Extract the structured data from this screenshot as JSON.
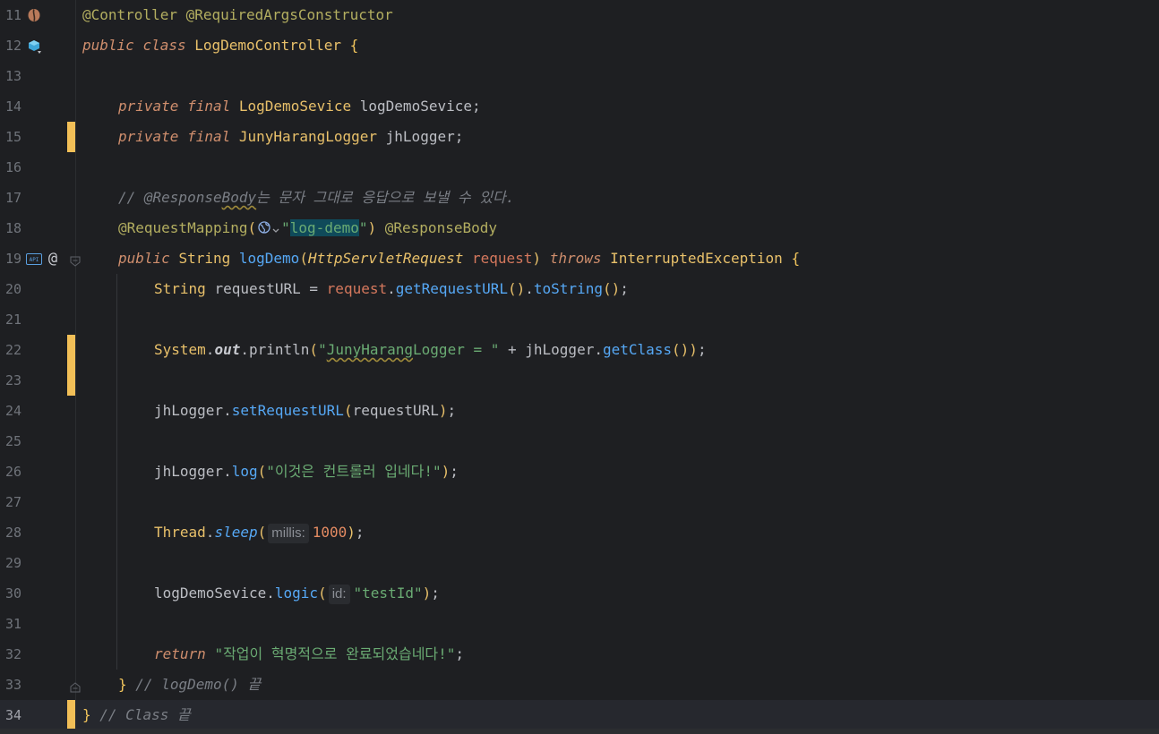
{
  "editor": {
    "lines": [
      {
        "n": "11"
      },
      {
        "n": "12"
      },
      {
        "n": "13"
      },
      {
        "n": "14"
      },
      {
        "n": "15"
      },
      {
        "n": "16"
      },
      {
        "n": "17"
      },
      {
        "n": "18"
      },
      {
        "n": "19"
      },
      {
        "n": "20"
      },
      {
        "n": "21"
      },
      {
        "n": "22"
      },
      {
        "n": "23"
      },
      {
        "n": "24"
      },
      {
        "n": "25"
      },
      {
        "n": "26"
      },
      {
        "n": "27"
      },
      {
        "n": "28"
      },
      {
        "n": "29"
      },
      {
        "n": "30"
      },
      {
        "n": "31"
      },
      {
        "n": "32"
      },
      {
        "n": "33"
      },
      {
        "n": "34"
      }
    ],
    "current_line": "34",
    "changed_lines": [
      "15",
      "22",
      "23",
      "34"
    ],
    "code": {
      "l11": {
        "ann1": "@Controller",
        "sp": " ",
        "ann2": "@RequiredArgsConstructor"
      },
      "l12": {
        "kw1": "public",
        "kw2": "class",
        "cls": "LogDemoController",
        "brace": "{"
      },
      "l14": {
        "kw1": "private",
        "kw2": "final",
        "type": "LogDemoSevice",
        "name": "logDemoSevice",
        "semi": ";"
      },
      "l15": {
        "kw1": "private",
        "kw2": "final",
        "type": "JunyHarangLogger",
        "name": "jhLogger",
        "semi": ";"
      },
      "l17": {
        "c1": "// @Response",
        "c2": "Body",
        "c3": "는 문자 그대로 응답으로 보낼 수 있다."
      },
      "l18": {
        "ann": "@RequestMapping",
        "p1": "(",
        "q1": "\"",
        "val": "log-demo",
        "q2": "\"",
        "p2": ")",
        "ann2": "@ResponseBody"
      },
      "l19": {
        "kw": "public",
        "type": "String",
        "meth": "logDemo",
        "p1": "(",
        "ptype": "HttpServletRequest",
        "pname": "request",
        "p2": ")",
        "throws": "throws",
        "exc": "InterruptedException",
        "brace": "{"
      },
      "l20": {
        "type": "String",
        "name": "requestURL",
        "eq": " = ",
        "obj": "request",
        "dot1": ".",
        "m1": "getRequestURL",
        "p1": "()",
        "dot2": ".",
        "m2": "toString",
        "p2": "()",
        "semi": ";"
      },
      "l22": {
        "cls": "System",
        "dot1": ".",
        "fld": "out",
        "dot2": ".",
        "m": "println",
        "p1": "(",
        "s1": "\"",
        "s2": "JunyHarang",
        "s3": "Logger = \"",
        "plus": " + ",
        "obj": "jhLogger",
        "dot3": ".",
        "m2": "getClass",
        "p2": "())",
        "semi": ";"
      },
      "l24": {
        "obj": "jhLogger",
        "dot": ".",
        "m": "setRequestURL",
        "p1": "(",
        "arg": "requestURL",
        "p2": ")",
        "semi": ";"
      },
      "l26": {
        "obj": "jhLogger",
        "dot": ".",
        "m": "log",
        "p1": "(",
        "str": "\"이것은 컨트롤러 입네다!\"",
        "p2": ")",
        "semi": ";"
      },
      "l28": {
        "cls": "Thread",
        "dot": ".",
        "m": "sleep",
        "p1": "(",
        "hint": "millis:",
        "num": "1000",
        "p2": ")",
        "semi": ";"
      },
      "l30": {
        "obj": "logDemoSevice",
        "dot": ".",
        "m": "logic",
        "p1": "(",
        "hint": "id:",
        "str": "\"testId\"",
        "p2": ")",
        "semi": ";"
      },
      "l32": {
        "kw": "return",
        "str": "\"작업이 혁명적으로 완료되었습네다!\"",
        "semi": ";"
      },
      "l33": {
        "brace": "}",
        "cmt": "// logDemo() 끝"
      },
      "l34": {
        "brace": "}",
        "cmt": "// Class 끝"
      }
    }
  },
  "colors": {
    "background": "#1e1f22",
    "keyword": "#cf8e6d",
    "string": "#6aab73",
    "method": "#56a8f5",
    "annotation": "#b3ae60",
    "comment": "#7a7e85",
    "number": "#e48b62",
    "change_marker": "#f2bf57"
  },
  "icons": {
    "l11": "spring-bean-icon",
    "l12": "class-implemented-icon",
    "l19a": "api-endpoint-icon",
    "l19b": "at-mapping-icon",
    "l18": "globe-icon"
  }
}
